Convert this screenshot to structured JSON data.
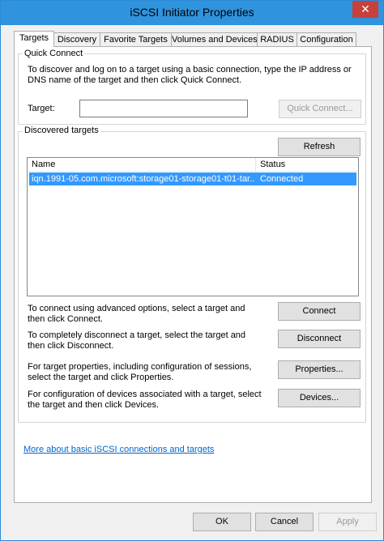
{
  "window": {
    "title": "iSCSI Initiator Properties",
    "close_glyph": "✕"
  },
  "tabs": [
    "Targets",
    "Discovery",
    "Favorite Targets",
    "Volumes and Devices",
    "RADIUS",
    "Configuration"
  ],
  "quick_connect": {
    "group_label": "Quick Connect",
    "description": "To discover and log on to a target using a basic connection, type the IP address or DNS name of the target and then click Quick Connect.",
    "target_label": "Target:",
    "target_value": "",
    "button_label": "Quick Connect..."
  },
  "discovered": {
    "group_label": "Discovered targets",
    "refresh_label": "Refresh",
    "columns": [
      "Name",
      "Status"
    ],
    "rows": [
      {
        "name": "iqn.1991-05.com.microsoft:storage01-storage01-t01-tar...",
        "status": "Connected"
      }
    ]
  },
  "actions": [
    {
      "description": "To connect using advanced options, select a target and then click Connect.",
      "button": "Connect"
    },
    {
      "description": "To completely disconnect a target, select the target and then click Disconnect.",
      "button": "Disconnect"
    },
    {
      "description": "For target properties, including configuration of sessions, select the target and click Properties.",
      "button": "Properties..."
    },
    {
      "description": "For configuration of devices associated with a target, select the target and then click Devices.",
      "button": "Devices..."
    }
  ],
  "help_link": "More about basic iSCSI connections and targets",
  "footer": {
    "ok": "OK",
    "cancel": "Cancel",
    "apply": "Apply"
  }
}
